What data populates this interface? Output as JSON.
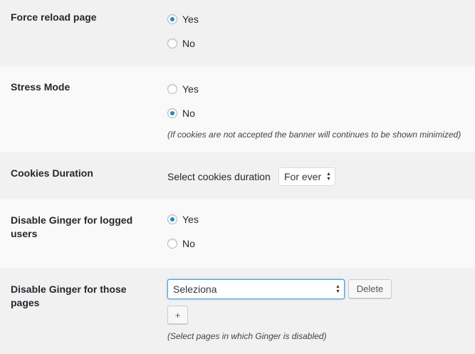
{
  "force_reload": {
    "label": "Force reload page",
    "options": [
      {
        "text": "Yes",
        "checked": true
      },
      {
        "text": "No",
        "checked": false
      }
    ]
  },
  "stress_mode": {
    "label": "Stress Mode",
    "options": [
      {
        "text": "Yes",
        "checked": false
      },
      {
        "text": "No",
        "checked": true
      }
    ],
    "note": "(If cookies are not accepted the banner will continues to be shown minimized)"
  },
  "cookies_duration": {
    "label": "Cookies Duration",
    "prompt": "Select cookies duration",
    "selected": "For ever"
  },
  "disable_logged": {
    "label": "Disable Ginger for logged users",
    "options": [
      {
        "text": "Yes",
        "checked": true
      },
      {
        "text": "No",
        "checked": false
      }
    ]
  },
  "disable_pages": {
    "label": "Disable Ginger for those pages",
    "selected": "Seleziona",
    "delete_label": "Delete",
    "add_label": "+",
    "note": "(Select pages in which Ginger is disabled)"
  },
  "colors": {
    "radio_checked": "#1e8cbe",
    "row_gray": "#f1f1f1",
    "row_light": "#f9f9f9",
    "focus_border": "#5b9dd9"
  }
}
